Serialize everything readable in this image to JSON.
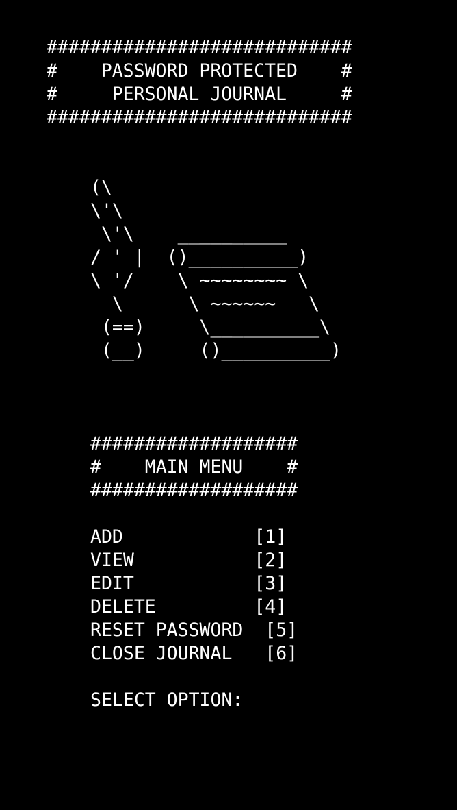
{
  "colors": {
    "background": "#000000",
    "text": "#ffffff"
  },
  "banner": {
    "border_top": "############################",
    "line1": "#    PASSWORD PROTECTED    #",
    "line2": "#     PERSONAL JOURNAL     #",
    "border_bottom": "############################"
  },
  "art": {
    "lines": [
      "(\\",
      "\\'\\",
      " \\'\\    __________",
      "/ ' |  ()__________)",
      "\\ '/    \\ ~~~~~~~~ \\",
      "  \\      \\ ~~~~~~   \\",
      " (==)     \\__________\\",
      " (__)     ()__________)"
    ]
  },
  "menu": {
    "border_top": "###################",
    "title": "#    MAIN MENU    #",
    "border_bottom": "###################",
    "items": [
      {
        "label": "ADD            [1]"
      },
      {
        "label": "VIEW           [2]"
      },
      {
        "label": "EDIT           [3]"
      },
      {
        "label": "DELETE         [4]"
      },
      {
        "label": "RESET PASSWORD  [5]"
      },
      {
        "label": "CLOSE JOURNAL   [6]"
      }
    ],
    "prompt": "SELECT OPTION:"
  }
}
